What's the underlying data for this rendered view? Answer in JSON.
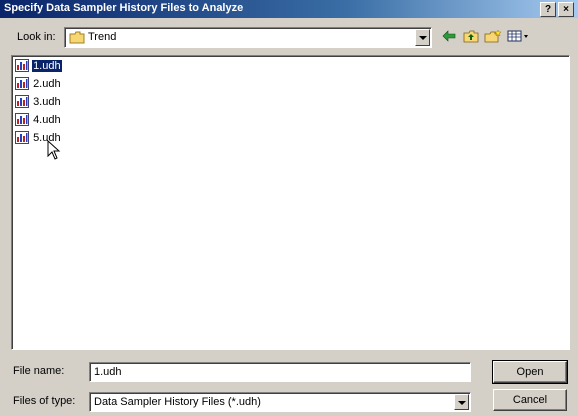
{
  "window": {
    "title": "Specify Data Sampler History Files to Analyze",
    "help_label": "?",
    "close_label": "×"
  },
  "lookin": {
    "label": "Look in:",
    "value": "Trend"
  },
  "toolbar": {
    "back_icon": "back-arrow-icon",
    "up_icon": "up-folder-icon",
    "new_folder_icon": "new-folder-icon",
    "view_menu_icon": "view-menu-icon"
  },
  "files": [
    {
      "name": "1.udh",
      "selected": true
    },
    {
      "name": "2.udh",
      "selected": false
    },
    {
      "name": "3.udh",
      "selected": false
    },
    {
      "name": "4.udh",
      "selected": false
    },
    {
      "name": "5.udh",
      "selected": false
    }
  ],
  "filename": {
    "label": "File name:",
    "value": "1.udh"
  },
  "filetype": {
    "label": "Files of type:",
    "value": "Data Sampler History Files (*.udh)"
  },
  "buttons": {
    "open": "Open",
    "cancel": "Cancel"
  },
  "colors": {
    "titlebar": "#0a246a",
    "face": "#d4d0c8",
    "selection": "#0a246a"
  }
}
